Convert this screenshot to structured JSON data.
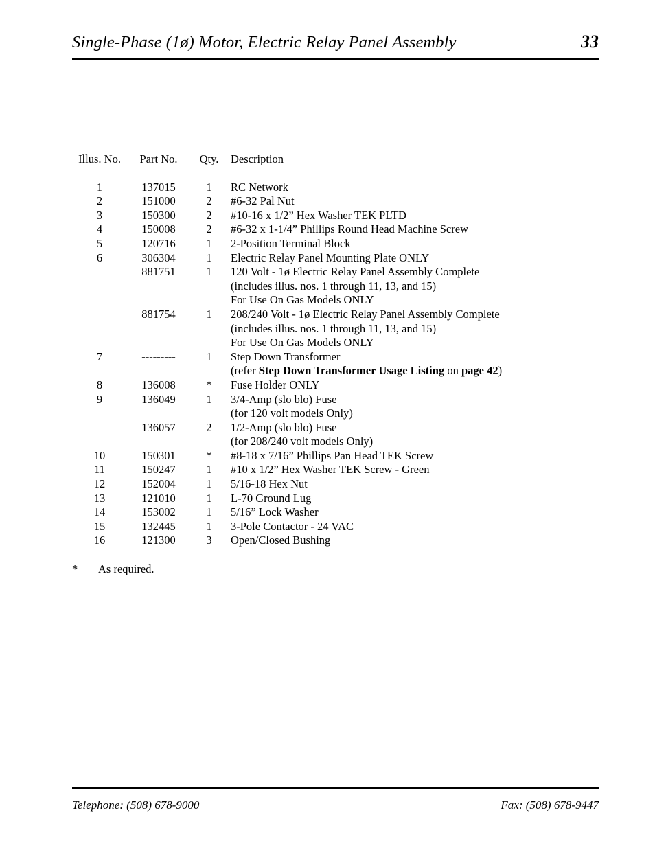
{
  "header": {
    "title": "Single-Phase (1ø) Motor, Electric Relay Panel Assembly",
    "page_number": "33"
  },
  "table": {
    "columns": {
      "illus": "Illus. No.",
      "part": "Part  No.",
      "qty": "Qty.",
      "description": "Description"
    },
    "rows": [
      {
        "illus": "1",
        "part": "137015",
        "qty": "1",
        "description": "RC Network"
      },
      {
        "illus": "2",
        "part": "151000",
        "qty": "2",
        "description": "#6-32 Pal Nut"
      },
      {
        "illus": "3",
        "part": "150300",
        "qty": "2",
        "description": "#10-16 x  1/2” Hex Washer TEK PLTD"
      },
      {
        "illus": "4",
        "part": "150008",
        "qty": "2",
        "description": "#6-32 x 1-1/4” Phillips Round Head Machine Screw"
      },
      {
        "illus": "5",
        "part": "120716",
        "qty": "1",
        "description": "2-Position Terminal Block"
      },
      {
        "illus": "6",
        "part": "306304",
        "qty": "1",
        "description": "Electric Relay Panel Mounting Plate ONLY"
      },
      {
        "illus": "",
        "part": "881751",
        "qty": "1",
        "description": "120 Volt - 1ø Electric Relay Panel Assembly Complete"
      },
      {
        "illus": "",
        "part": "",
        "qty": "",
        "description": "(includes illus. nos. 1 through 11, 13, and 15)"
      },
      {
        "illus": "",
        "part": "",
        "qty": "",
        "description": "For Use On Gas Models ONLY"
      },
      {
        "illus": "",
        "part": "881754",
        "qty": "1",
        "description": "208/240 Volt - 1ø Electric Relay Panel Assembly Complete"
      },
      {
        "illus": "",
        "part": "",
        "qty": "",
        "description": "(includes illus. nos. 1 through 11, 13, and 15)"
      },
      {
        "illus": "",
        "part": "",
        "qty": "",
        "description": "For Use On Gas Models ONLY"
      },
      {
        "illus": "7",
        "part": "---------",
        "qty": "1",
        "description": "Step Down Transformer"
      },
      {
        "illus": "",
        "part": "",
        "qty": "",
        "description": "",
        "description_parts": [
          {
            "text": "(refer ",
            "style": "normal"
          },
          {
            "text": "Step Down Transformer Usage Listing",
            "style": "bold"
          },
          {
            "text": " on ",
            "style": "normal"
          },
          {
            "text": "page 42",
            "style": "bold-underline"
          },
          {
            "text": ")",
            "style": "normal"
          }
        ]
      },
      {
        "illus": "8",
        "part": "136008",
        "qty": "*",
        "description": "Fuse Holder ONLY"
      },
      {
        "illus": "9",
        "part": "136049",
        "qty": "1",
        "description": "3/4-Amp (slo blo) Fuse"
      },
      {
        "illus": "",
        "part": "",
        "qty": "",
        "description": "(for 120 volt models Only)"
      },
      {
        "illus": "",
        "part": "136057",
        "qty": "2",
        "description": "1/2-Amp (slo blo) Fuse"
      },
      {
        "illus": "",
        "part": "",
        "qty": "",
        "description": "(for 208/240 volt models Only)"
      },
      {
        "illus": "10",
        "part": "150301",
        "qty": "*",
        "description": "#8-18 x 7/16” Phillips Pan Head TEK Screw"
      },
      {
        "illus": "11",
        "part": "150247",
        "qty": "1",
        "description": "#10 x  1/2” Hex Washer TEK Screw - Green"
      },
      {
        "illus": "12",
        "part": "152004",
        "qty": "1",
        "description": "5/16-18 Hex Nut"
      },
      {
        "illus": "13",
        "part": "121010",
        "qty": "1",
        "description": "L-70 Ground Lug"
      },
      {
        "illus": "14",
        "part": "153002",
        "qty": "1",
        "description": "5/16” Lock Washer"
      },
      {
        "illus": "15",
        "part": "132445",
        "qty": "1",
        "description": "3-Pole Contactor - 24 VAC"
      },
      {
        "illus": "16",
        "part": "121300",
        "qty": "3",
        "description": "Open/Closed Bushing"
      }
    ]
  },
  "footnote": {
    "mark": "*",
    "text": "As required."
  },
  "footer": {
    "telephone": "Telephone: (508) 678-9000",
    "fax": "Fax: (508) 678-9447"
  }
}
